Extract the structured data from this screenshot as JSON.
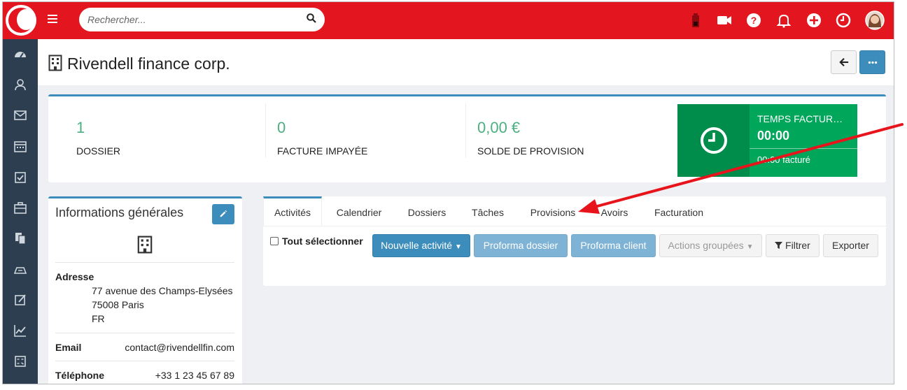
{
  "topbar": {
    "search_placeholder": "Rechercher...",
    "icons": [
      "battery-icon",
      "video-icon",
      "help-icon",
      "bell-icon",
      "add-icon",
      "clock-icon",
      "user-avatar"
    ]
  },
  "sidebar": {
    "icons": [
      "dashboard-icon",
      "contacts-icon",
      "mail-icon",
      "calendar-icon",
      "tasks-icon",
      "briefcase-icon",
      "documents-icon",
      "billing-icon",
      "edit-icon",
      "chart-icon",
      "calculator-icon"
    ]
  },
  "header": {
    "title": "Rivendell finance corp."
  },
  "stats": [
    {
      "value": "1",
      "label": "DOSSIER"
    },
    {
      "value": "0",
      "label": "FACTURE IMPAYÉE"
    },
    {
      "value": "0,00 €",
      "label": "SOLDE DE PROVISION"
    }
  ],
  "time_box": {
    "title": "TEMPS FACTUR…",
    "time": "00:00",
    "billed": "00:00 facturé"
  },
  "info": {
    "title": "Informations générales",
    "address_label": "Adresse",
    "address_lines": [
      "77 avenue des Champs-Elysées",
      "75008 Paris",
      "FR"
    ],
    "email_label": "Email",
    "email": "contact@rivendellfin.com",
    "phone_label": "Téléphone",
    "phone": "+33 1 23 45 67 89"
  },
  "tabs": [
    "Activités",
    "Calendrier",
    "Dossiers",
    "Tâches",
    "Provisions",
    "Avoirs",
    "Facturation"
  ],
  "toolbar": {
    "select_all": "Tout sélectionner",
    "new_activity": "Nouvelle activité",
    "proforma_dossier": "Proforma dossier",
    "proforma_client": "Proforma client",
    "grouped_actions": "Actions groupées",
    "filter": "Filtrer",
    "export": "Exporter"
  },
  "colors": {
    "brand_red": "#e3161f",
    "sidebar": "#2c3e50",
    "primary": "#3c8dbc",
    "success": "#00a65a",
    "stat_value": "#4caf82",
    "annotation_arrow": "#e8141b"
  }
}
